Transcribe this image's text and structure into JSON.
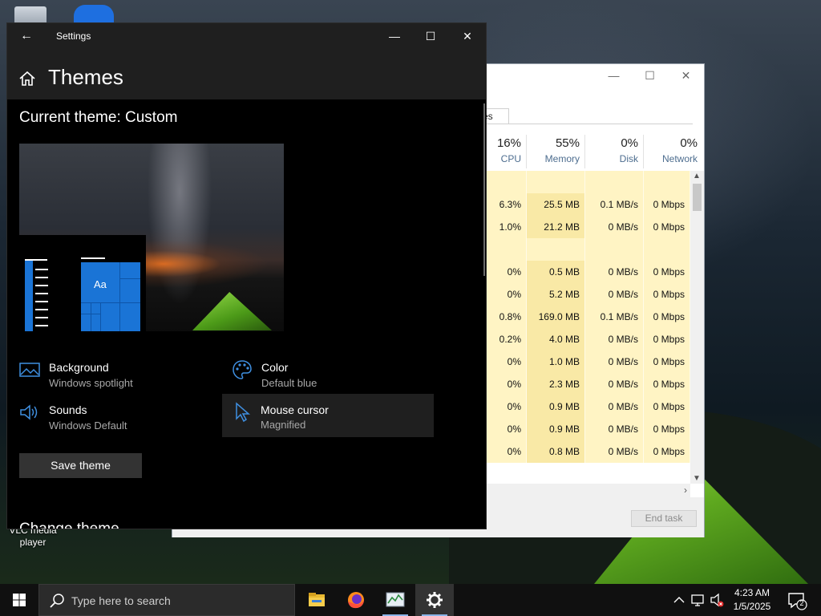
{
  "desktop": {
    "icon_label": "VLC media player"
  },
  "taskmgr": {
    "tab_label": "es",
    "columns": [
      {
        "pct": "16%",
        "label": "CPU"
      },
      {
        "pct": "55%",
        "label": "Memory"
      },
      {
        "pct": "0%",
        "label": "Disk"
      },
      {
        "pct": "0%",
        "label": "Network"
      }
    ],
    "rows": [
      {
        "cpu": "",
        "mem": "",
        "disk": "",
        "net": "",
        "group": true
      },
      {
        "cpu": "6.3%",
        "mem": "25.5 MB",
        "disk": "0.1 MB/s",
        "net": "0 Mbps"
      },
      {
        "cpu": "1.0%",
        "mem": "21.2 MB",
        "disk": "0 MB/s",
        "net": "0 Mbps"
      },
      {
        "cpu": "",
        "mem": "",
        "disk": "",
        "net": "",
        "group": true
      },
      {
        "cpu": "0%",
        "mem": "0.5 MB",
        "disk": "0 MB/s",
        "net": "0 Mbps"
      },
      {
        "cpu": "0%",
        "mem": "5.2 MB",
        "disk": "0 MB/s",
        "net": "0 Mbps"
      },
      {
        "cpu": "0.8%",
        "mem": "169.0 MB",
        "disk": "0.1 MB/s",
        "net": "0 Mbps"
      },
      {
        "cpu": "0.2%",
        "mem": "4.0 MB",
        "disk": "0 MB/s",
        "net": "0 Mbps"
      },
      {
        "cpu": "0%",
        "mem": "1.0 MB",
        "disk": "0 MB/s",
        "net": "0 Mbps"
      },
      {
        "cpu": "0%",
        "mem": "2.3 MB",
        "disk": "0 MB/s",
        "net": "0 Mbps"
      },
      {
        "cpu": "0%",
        "mem": "0.9 MB",
        "disk": "0 MB/s",
        "net": "0 Mbps"
      },
      {
        "cpu": "0%",
        "mem": "0.9 MB",
        "disk": "0 MB/s",
        "net": "0 Mbps"
      },
      {
        "cpu": "0%",
        "mem": "0.8 MB",
        "disk": "0 MB/s",
        "net": "0 Mbps"
      }
    ],
    "end_task_label": "End task"
  },
  "settings": {
    "window_title": "Settings",
    "page_title": "Themes",
    "current_theme": "Current theme: Custom",
    "preview_sample_text": "Aa",
    "items": [
      {
        "name": "Background",
        "value": "Windows spotlight",
        "icon": "picture-icon"
      },
      {
        "name": "Color",
        "value": "Default blue",
        "icon": "palette-icon"
      },
      {
        "name": "Sounds",
        "value": "Windows Default",
        "icon": "speaker-icon"
      },
      {
        "name": "Mouse cursor",
        "value": "Magnified",
        "icon": "cursor-icon"
      }
    ],
    "save_theme_label": "Save theme",
    "change_theme_heading": "Change theme",
    "accent_color": "#1a74d6"
  },
  "taskbar": {
    "search_placeholder": "Type here to search",
    "apps": [
      "file-explorer-icon",
      "firefox-icon",
      "task-manager-icon",
      "settings-icon"
    ],
    "clock_time": "4:23 AM",
    "clock_date": "1/5/2025",
    "notification_count": "2"
  }
}
